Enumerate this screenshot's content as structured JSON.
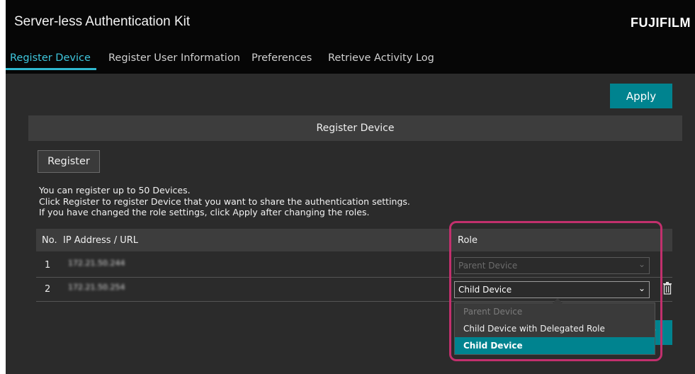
{
  "header": {
    "app_title": "Server-less Authentication Kit",
    "brand": "FUJIFILM"
  },
  "tabs": [
    {
      "label": "Register Device",
      "active": true
    },
    {
      "label": "Register User Information",
      "active": false
    },
    {
      "label": "Preferences",
      "active": false
    },
    {
      "label": "Retrieve Activity Log",
      "active": false
    }
  ],
  "toolbar": {
    "apply_label": "Apply"
  },
  "section": {
    "title": "Register Device",
    "register_label": "Register",
    "info_lines": [
      "You can register up to 50 Devices.",
      "Click Register to register Device that you want to share the authentication settings.",
      "If you have changed the role settings, click Apply after changing the roles."
    ]
  },
  "table": {
    "columns": {
      "no": "No.",
      "address": "IP Address / URL",
      "role": "Role"
    },
    "rows": [
      {
        "no": "1",
        "address": "172.21.50.244",
        "role": "Parent Device",
        "role_enabled": false
      },
      {
        "no": "2",
        "address": "172.21.50.254",
        "role": "Child Device",
        "role_enabled": true
      }
    ]
  },
  "role_dropdown": {
    "options": [
      {
        "label": "Parent Device",
        "disabled": true
      },
      {
        "label": "Child Device with Delegated Role",
        "disabled": false
      },
      {
        "label": "Child Device",
        "selected": true
      }
    ]
  },
  "bottom_apply_partial": "y",
  "colors": {
    "accent": "#00838f",
    "tab_active": "#3ec6dd",
    "highlight": "#c2306d",
    "background": "#2b2b2b",
    "header": "#060606"
  },
  "icons": {
    "chevron": "chevron-down-icon",
    "delete": "trash-icon"
  }
}
